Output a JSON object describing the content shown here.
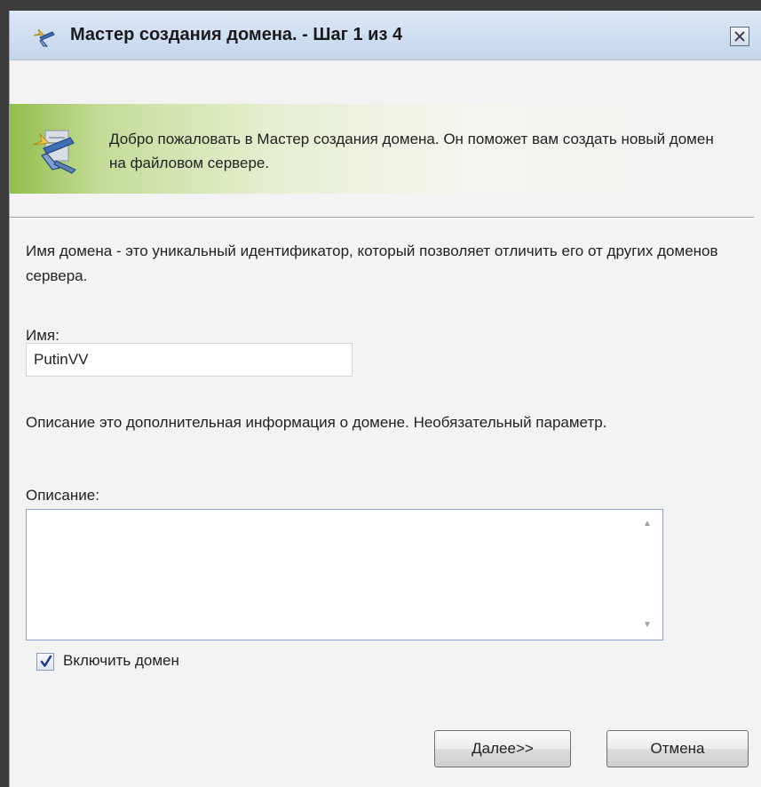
{
  "titlebar": {
    "title": "Мастер создания домена. - Шаг 1 из 4",
    "icon": "wizard-icon",
    "close_icon": "close-icon"
  },
  "banner": {
    "icon": "wizard-icon",
    "text": "Добро пожаловать в Мастер создания домена. Он поможет вам создать новый домен на файловом сервере."
  },
  "name_section": {
    "description": "Имя домена - это уникальный идентификатор, который позволяет отличить его от других доменов сервера.",
    "label": "Имя:",
    "value": "PutinVV"
  },
  "description_section": {
    "description": "Описание это дополнительная информация о домене. Необязательный параметр.",
    "label": "Описание:",
    "value": ""
  },
  "enable_domain": {
    "label": "Включить домен",
    "checked": true
  },
  "buttons": {
    "next_label": "Далее>>",
    "cancel_label": "Отмена"
  },
  "colors": {
    "titlebar": "#c4d5ec",
    "banner_accent": "#92be4a",
    "dialog_bg": "#f3f3f3"
  }
}
